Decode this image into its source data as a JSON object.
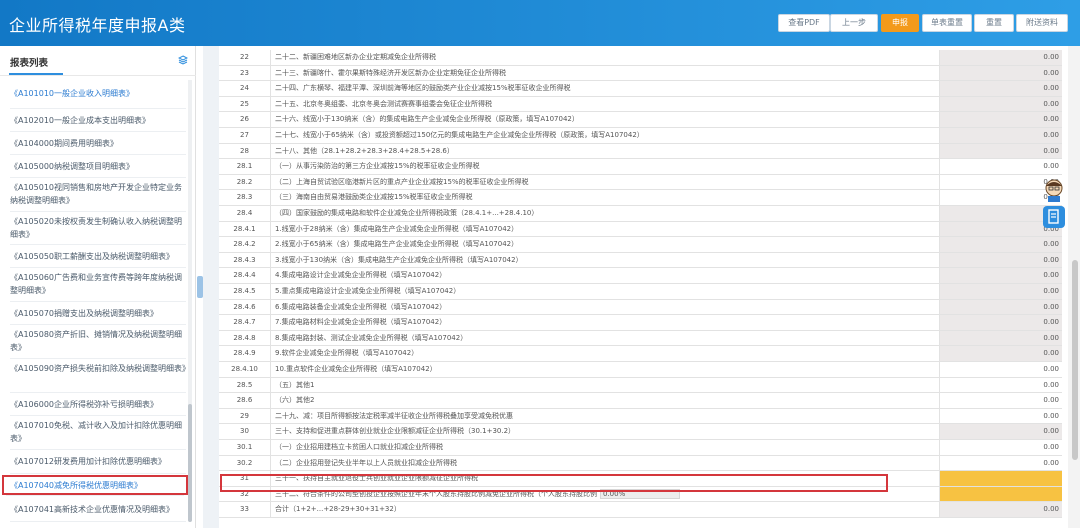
{
  "header": {
    "title": "企业所得税年度申报A类",
    "buttons": [
      {
        "label": "查看PDF"
      },
      {
        "label": "上一步"
      },
      {
        "label": "申报"
      },
      {
        "label": "单表重置"
      },
      {
        "label": "重置"
      },
      {
        "label": "附送资料"
      }
    ]
  },
  "sidebar": {
    "title": "报表列表",
    "items": [
      {
        "label": "《A101010一般企业收入明细表》"
      },
      {
        "label": "《A102010一般企业成本支出明细表》"
      },
      {
        "label": "《A104000期间费用明细表》"
      },
      {
        "label": "《A105000纳税调整项目明细表》"
      },
      {
        "label": "《A105010视同销售和房地产开发企业特定业务纳税调整明细表》"
      },
      {
        "label": "《A105020未按权责发生制确认收入纳税调整明细表》"
      },
      {
        "label": "《A105050职工薪酬支出及纳税调整明细表》"
      },
      {
        "label": "《A105060广告费和业务宣传费等跨年度纳税调整明细表》"
      },
      {
        "label": "《A105070捐赠支出及纳税调整明细表》"
      },
      {
        "label": "《A105080资产折旧、摊销情况及纳税调整明细表》"
      },
      {
        "label": "《A105090资产损失税前扣除及纳税调整明细表》"
      },
      {
        "label": "《A106000企业所得税弥补亏损明细表》"
      },
      {
        "label": "《A107010免税、减计收入及加计扣除优惠明细表》"
      },
      {
        "label": "《A107012研发费用加计扣除优惠明细表》"
      },
      {
        "label": "《A107040减免所得税优惠明细表》"
      },
      {
        "label": "《A107041高新技术企业优惠情况及明细表》"
      }
    ]
  },
  "table": {
    "rows": [
      {
        "num": "22",
        "name": "二十二、新疆困难地区新办企业定期减免企业所得税",
        "value": "0.00"
      },
      {
        "num": "23",
        "name": "二十三、新疆喀什、霍尔果斯特殊经济开发区新办企业定期免征企业所得税",
        "value": "0.00"
      },
      {
        "num": "24",
        "name": "二十四、广东横琴、福建平潭、深圳前海等地区的鼓励类产业企业减按15%税率征收企业所得税",
        "value": "0.00"
      },
      {
        "num": "25",
        "name": "二十五、北京冬奥组委、北京冬奥会测试赛赛事组委会免征企业所得税",
        "value": "0.00"
      },
      {
        "num": "26",
        "name": "二十六、线宽小于130纳米（含）的集成电路生产企业减免企业所得税（原政策，填写A107042）",
        "value": "0.00"
      },
      {
        "num": "27",
        "name": "二十七、线宽小于65纳米（含）或投资额超过150亿元的集成电路生产企业减免企业所得税（原政策，填写A107042）",
        "value": "0.00"
      },
      {
        "num": "28",
        "name": "二十八、其他（28.1+28.2+28.3+28.4+28.5+28.6）",
        "value": "0.00"
      },
      {
        "num": "28.1",
        "name": "（一）从事污染防治的第三方企业减按15%的税率征收企业所得税",
        "value": "0.00"
      },
      {
        "num": "28.2",
        "name": "（二）上海自贸试验区临港新片区的重点产业企业减按15%的税率征收企业所得税",
        "value": "0.00"
      },
      {
        "num": "28.3",
        "name": "（三）海南自由贸易港鼓励类企业减按15%税率征收企业所得税",
        "value": "0.00"
      },
      {
        "num": "28.4",
        "name": "（四）国家鼓励的集成电路和软件企业减免企业所得税政策（28.4.1+...+28.4.10）",
        "value": "0.00"
      },
      {
        "num": "28.4.1",
        "name": "1.线宽小于28纳米（含）集成电路生产企业减免企业所得税（填写A107042）",
        "value": "0.00"
      },
      {
        "num": "28.4.2",
        "name": "2.线宽小于65纳米（含）集成电路生产企业减免企业所得税（填写A107042）",
        "value": "0.00"
      },
      {
        "num": "28.4.3",
        "name": "3.线宽小于130纳米（含）集成电路生产企业减免企业所得税（填写A107042）",
        "value": "0.00"
      },
      {
        "num": "28.4.4",
        "name": "4.集成电路设计企业减免企业所得税（填写A107042）",
        "value": "0.00"
      },
      {
        "num": "28.4.5",
        "name": "5.重点集成电路设计企业减免企业所得税（填写A107042）",
        "value": "0.00"
      },
      {
        "num": "28.4.6",
        "name": "6.集成电路装备企业减免企业所得税（填写A107042）",
        "value": "0.00"
      },
      {
        "num": "28.4.7",
        "name": "7.集成电路材料企业减免企业所得税（填写A107042）",
        "value": "0.00"
      },
      {
        "num": "28.4.8",
        "name": "8.集成电路封装、测试企业减免企业所得税（填写A107042）",
        "value": "0.00"
      },
      {
        "num": "28.4.9",
        "name": "9.软件企业减免企业所得税（填写A107042）",
        "value": "0.00"
      },
      {
        "num": "28.4.10",
        "name": "10.重点软件企业减免企业所得税（填写A107042）",
        "value": "0.00"
      },
      {
        "num": "28.5",
        "name": "（五）其他1",
        "value": "0.00"
      },
      {
        "num": "28.6",
        "name": "（六）其他2",
        "value": "0.00"
      },
      {
        "num": "29",
        "name": "二十九、减：项目所得额按法定税率减半征收企业所得税叠加享受减免税优惠",
        "value": "0.00"
      },
      {
        "num": "30",
        "name": "三十、支持和促进重点群体创业就业企业限额减征企业所得税（30.1+30.2）",
        "value": "0.00"
      },
      {
        "num": "30.1",
        "name": "（一）企业招用建档立卡贫困人口就业扣减企业所得税",
        "value": "0.00"
      },
      {
        "num": "30.2",
        "name": "（二）企业招用登记失业半年以上人员就业扣减企业所得税",
        "value": "0.00"
      },
      {
        "num": "31",
        "name": "三十一、扶持自主就业退役士兵创业就业企业限额减征企业所得税",
        "value": ""
      },
      {
        "num": "32",
        "name": "三十二、符合条件的公司型创投企业按照企业年末个人股东持股比例减免企业所得税（个人股东持股比例",
        "value": "",
        "pct": "0.00%"
      },
      {
        "num": "33",
        "name": "合计（1+2+...+28-29+30+31+32）",
        "value": "0.00"
      }
    ]
  }
}
